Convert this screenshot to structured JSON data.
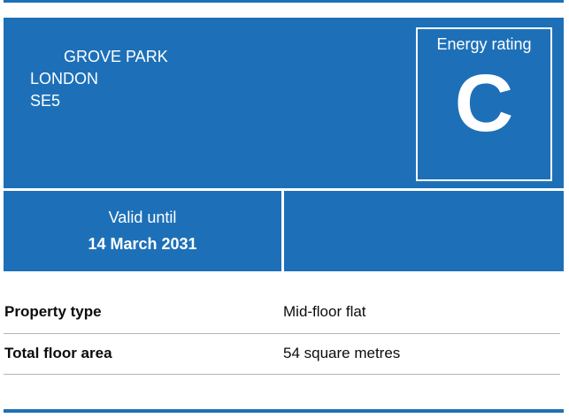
{
  "certificate": {
    "address": {
      "line1": "GROVE PARK",
      "line2": "LONDON",
      "line3": "SE5"
    },
    "energy_rating": {
      "label": "Energy rating",
      "value": "C"
    },
    "validity": {
      "label": "Valid until",
      "date": "14 March 2031"
    }
  },
  "summary": [
    {
      "key": "Property type",
      "value": "Mid-floor flat"
    },
    {
      "key": "Total floor area",
      "value": "54 square metres"
    }
  ],
  "colors": {
    "accent": "#1d70b8",
    "text": "#0b0c0c",
    "border": "#b1b4b6"
  }
}
